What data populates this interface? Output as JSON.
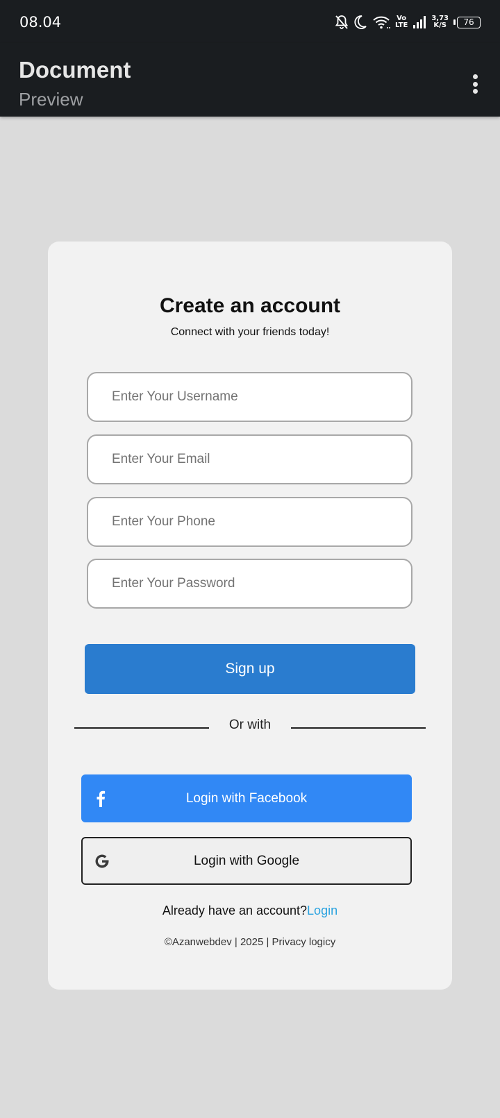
{
  "status_bar": {
    "time": "08.04",
    "network_label_top": "Vo",
    "network_label_bottom": "LTE",
    "speed_top": "3,73",
    "speed_bottom": "K/S",
    "battery": "76"
  },
  "app_bar": {
    "title": "Document",
    "subtitle": "Preview"
  },
  "form": {
    "title": "Create an account",
    "subtitle": "Connect with your friends today!",
    "username_placeholder": "Enter Your Username",
    "email_placeholder": "Enter Your Email",
    "phone_placeholder": "Enter Your Phone",
    "password_placeholder": "Enter Your Password",
    "signup_label": "Sign up",
    "divider_text": "Or with",
    "facebook_label": "Login with Facebook",
    "google_label": "Login with Google",
    "already_text": "Already have an account?",
    "login_link": "Login",
    "footer": "©Azanwebdev | 2025 | Privacy logicy"
  },
  "colors": {
    "app_bar": "#1a1d20",
    "page_background": "#dbdbdb",
    "signup_button": "#2a7ccf",
    "facebook_button": "#3188f5",
    "login_link": "#2aa3e0"
  },
  "icons": [
    "mute-icon",
    "moon-icon",
    "wifi-icon",
    "signal-icon",
    "battery-icon",
    "more-vert-icon",
    "facebook-icon",
    "google-icon"
  ]
}
